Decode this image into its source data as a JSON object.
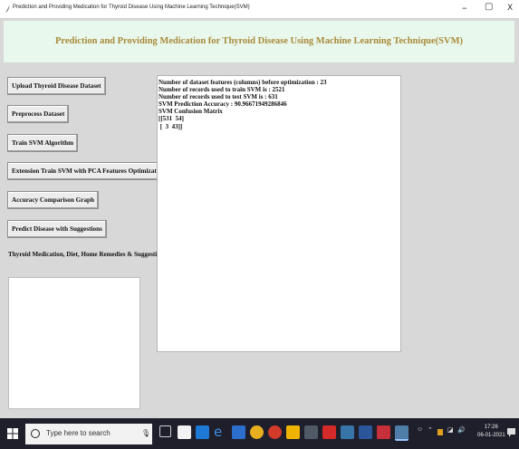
{
  "window": {
    "title": "Prediction and Providing Medication for Thyroid Disease Using Machine Learning Technique(SVM)",
    "minimize": "–",
    "maximize": "▢",
    "close": "X"
  },
  "header": {
    "title": "Prediction and Providing Medication for Thyroid Disease Using Machine Learning Technique(SVM)",
    "background": "#e8f8ec",
    "title_color": "#a98a3a"
  },
  "buttons": {
    "upload": "Upload Thyroid Disease Dataset",
    "preprocess": "Preprocess Dataset",
    "train_svm": "Train SVM Algorithm",
    "extension": "Extension Train SVM with PCA Features Optimization",
    "accuracy_graph": "Accuracy Comparison Graph",
    "predict": "Predict Disease with Suggestions",
    "medication": "Thyroid Medication, Diet, Home Remedies & Suggestion"
  },
  "output": {
    "lines": [
      "Number of dataset features (columns) before optimization : 23",
      "Number of records used to train SVM is : 2521",
      "Number of records used to test SVM is : 631",
      "SVM Prediction Accuracy : 90.96671949286846",
      "",
      "SVM Confusion Matrix",
      "[[531  54]",
      " [  3  43]]"
    ]
  },
  "taskbar": {
    "search_placeholder": "Type here to search",
    "time": "17:26",
    "date": "06-01-2021",
    "icons": [
      "task-view-icon",
      "store-icon",
      "mail-icon",
      "edge-icon",
      "media-icon",
      "chrome-icon",
      "app-icon",
      "file-explorer-icon",
      "pdf-icon",
      "python-icon",
      "word-icon",
      "notes-icon",
      "tk-icon"
    ]
  }
}
